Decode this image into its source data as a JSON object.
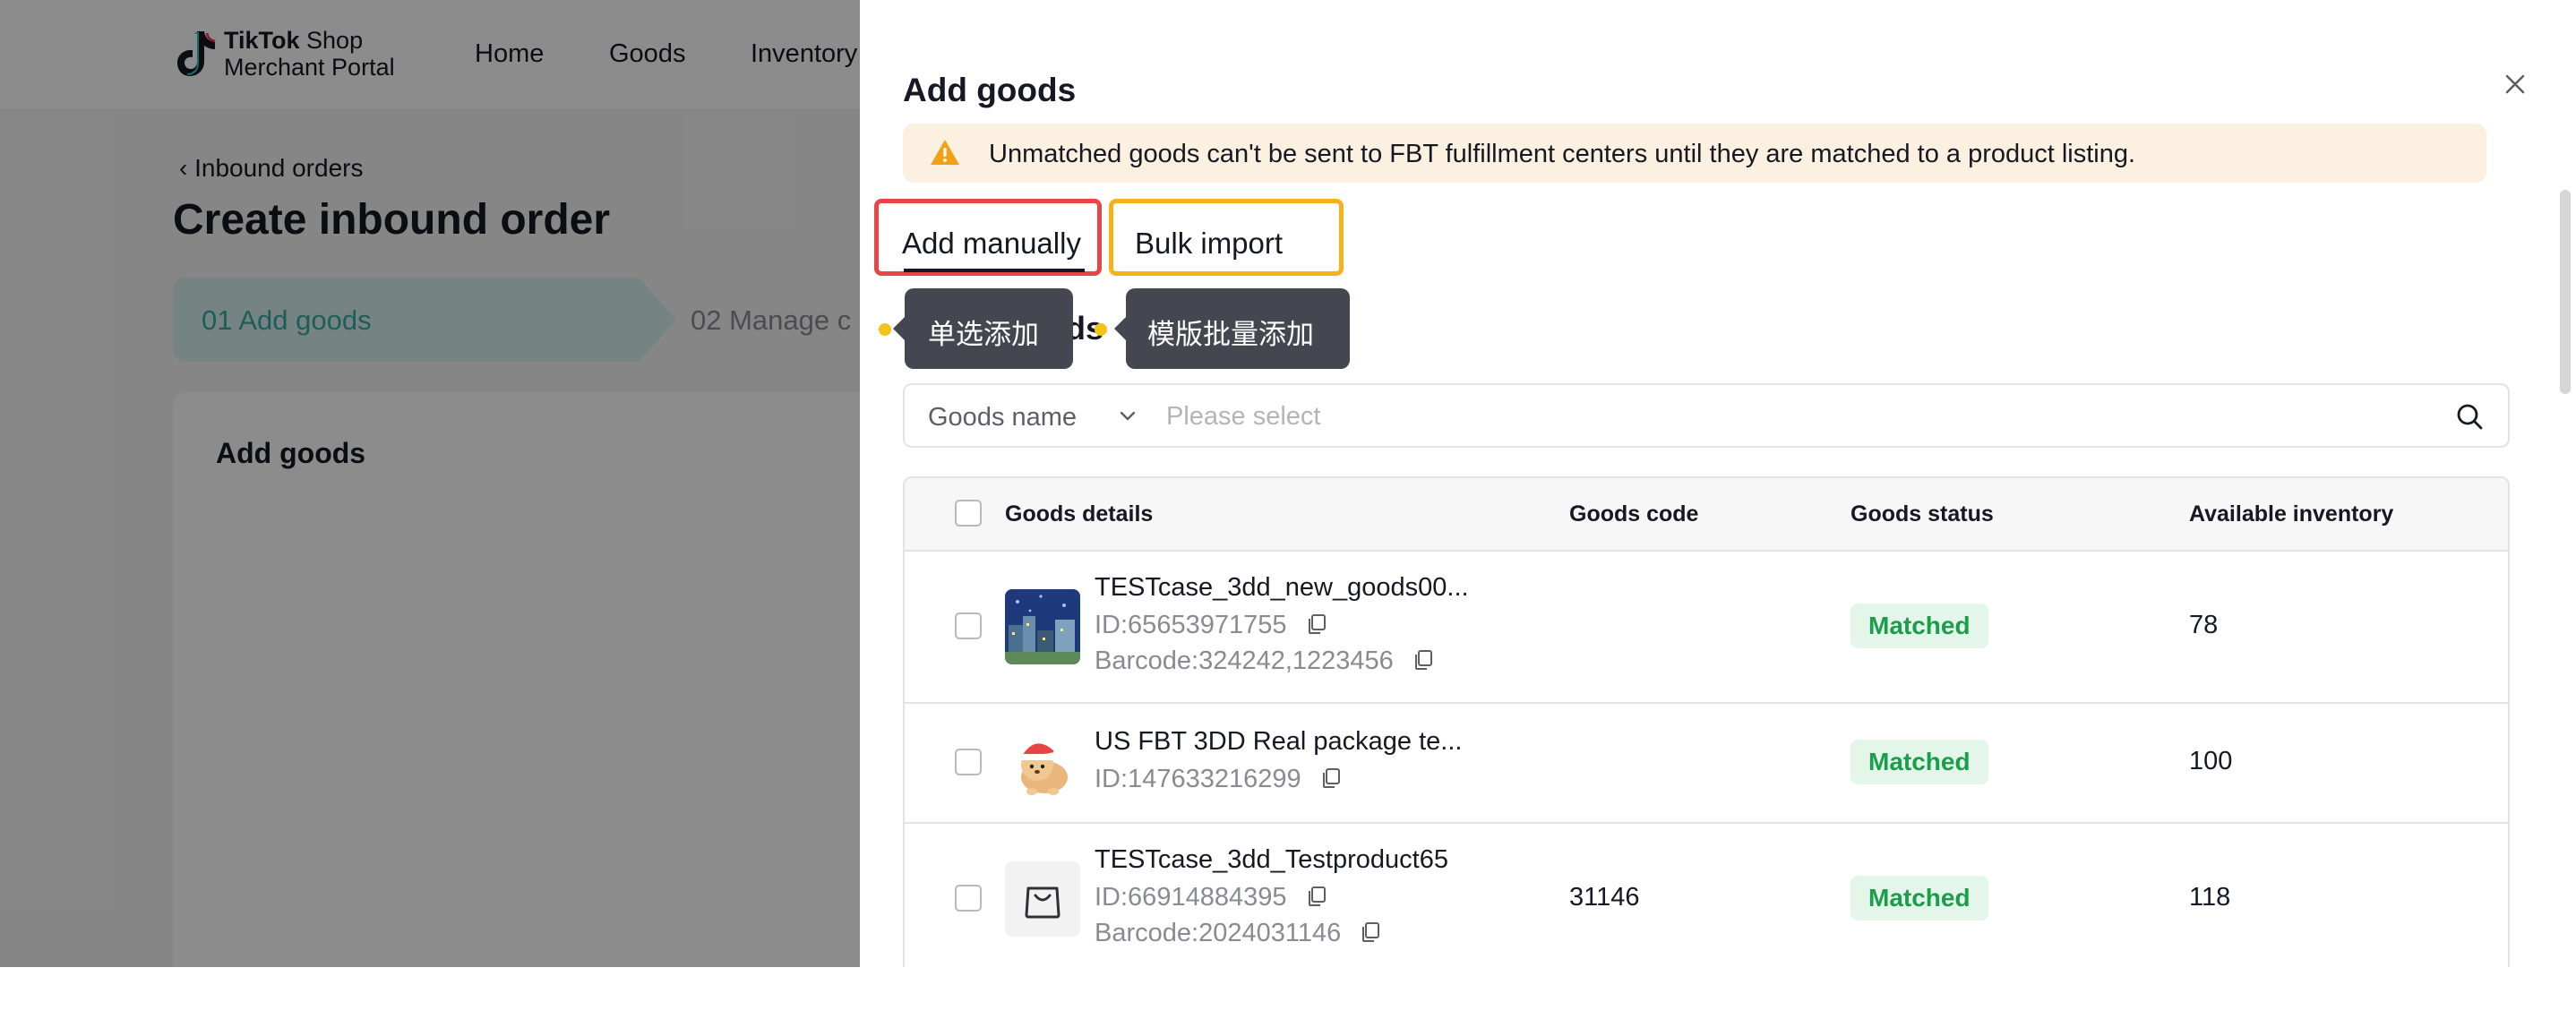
{
  "nav": {
    "logo_line1_bold": "TikTok",
    "logo_line1_rest": " Shop",
    "logo_line2": "Merchant Portal",
    "links": [
      "Home",
      "Goods",
      "Inventory"
    ]
  },
  "page": {
    "back_link": "Inbound orders",
    "title": "Create inbound order",
    "steps": [
      "01 Add goods",
      "02 Manage c"
    ],
    "card_title": "Add goods"
  },
  "drawer": {
    "title": "Add goods",
    "alert": "Unmatched goods can't be sent to FBT fulfillment centers until they are matched to a product listing.",
    "tabs": [
      "Add manually",
      "Bulk import"
    ],
    "section_heading": "Select goods",
    "tooltips": {
      "single": "单选添加",
      "bulk": "模版批量添加"
    },
    "search": {
      "field": "Goods name",
      "placeholder": "Please select"
    },
    "table": {
      "headers": [
        "Goods details",
        "Goods code",
        "Goods status",
        "Available inventory"
      ],
      "rows": [
        {
          "name": "TESTcase_3dd_new_goods00...",
          "id": "ID:65653971755",
          "barcode": "Barcode:324242,1223456",
          "code": "",
          "status": "Matched",
          "inventory": "78",
          "thumb": "city-night-image"
        },
        {
          "name": "US FBT 3DD Real package te...",
          "id": "ID:147633216299",
          "barcode": "",
          "code": "",
          "status": "Matched",
          "inventory": "100",
          "thumb": "puppy-santa-hat-image"
        },
        {
          "name": "TESTcase_3dd_Testproduct65",
          "id": "ID:66914884395",
          "barcode": "Barcode:2024031146",
          "code": "31146",
          "status": "Matched",
          "inventory": "118",
          "thumb": "shopping-bag-icon"
        }
      ]
    }
  },
  "colors": {
    "accent_teal": "#3aa9a3",
    "matched_green": "#1a9e4b",
    "highlight_red": "#e84646",
    "highlight_yellow": "#f5b31a",
    "warning_orange": "#f2a116"
  }
}
